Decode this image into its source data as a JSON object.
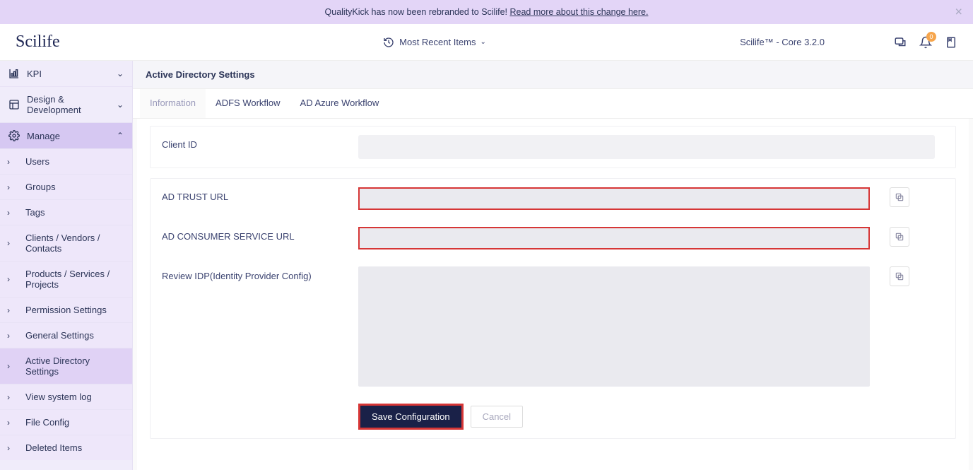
{
  "banner": {
    "text_before": "QualityKick has now been rebranded to Scilife! ",
    "link_text": "Read more about this change here."
  },
  "header": {
    "logo": "Scilife",
    "recent_items": "Most Recent Items",
    "version": "Scilife™ - Core 3.2.0",
    "notification_count": "0"
  },
  "sidebar": {
    "kpi": "KPI",
    "design_dev": "Design & Development",
    "manage": "Manage",
    "items": [
      {
        "label": "Users"
      },
      {
        "label": "Groups"
      },
      {
        "label": "Tags"
      },
      {
        "label": "Clients / Vendors / Contacts"
      },
      {
        "label": "Products / Services / Projects"
      },
      {
        "label": "Permission Settings"
      },
      {
        "label": "General Settings"
      },
      {
        "label": "Active Directory Settings"
      },
      {
        "label": "View system log"
      },
      {
        "label": "File Config"
      },
      {
        "label": "Deleted Items"
      }
    ]
  },
  "page": {
    "title": "Active Directory Settings",
    "tabs": {
      "information": "Information",
      "adfs": "ADFS Workflow",
      "azure": "AD Azure Workflow"
    },
    "form": {
      "client_id_label": "Client ID",
      "client_id_value": "",
      "ad_trust_label": "AD TRUST URL",
      "ad_trust_value": "",
      "ad_consumer_label": "AD CONSUMER SERVICE URL",
      "ad_consumer_value": "",
      "review_idp_label": "Review IDP(Identity Provider Config)",
      "review_idp_value": "",
      "save_label": "Save Configuration",
      "cancel_label": "Cancel"
    }
  }
}
